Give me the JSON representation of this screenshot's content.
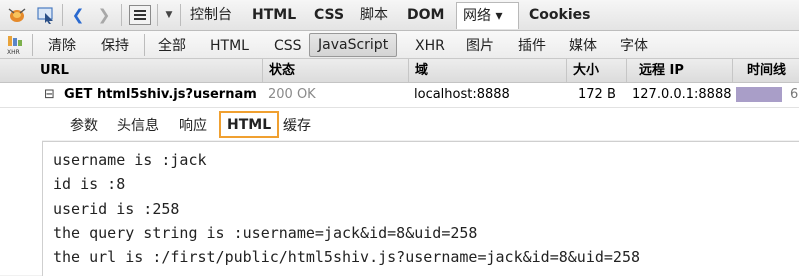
{
  "toolbar": {
    "icons": [
      "firebug-icon",
      "inspect-icon",
      "back-icon",
      "forward-icon",
      "menu-icon",
      "dropdown-icon"
    ],
    "tabs": [
      {
        "label": "控制台"
      },
      {
        "label": "HTML"
      },
      {
        "label": "CSS"
      },
      {
        "label": "脚本"
      },
      {
        "label": "DOM"
      },
      {
        "label": "网络 ▾"
      },
      {
        "label": "Cookies"
      }
    ]
  },
  "filters": {
    "items": [
      "清除",
      "保持",
      "全部",
      "HTML",
      "CSS",
      "JavaScript",
      "XHR",
      "图片",
      "插件",
      "媒体",
      "字体"
    ],
    "active": "JavaScript"
  },
  "columns": [
    "URL",
    "状态",
    "域",
    "大小",
    "远程 IP",
    "时间线"
  ],
  "request": {
    "toggle": "⊟",
    "url": "GET html5shiv.js?usernam",
    "status": "200 OK",
    "domain": "localhost:8888",
    "size": "172 B",
    "remote_ip": "127.0.0.1:8888",
    "timeline_text": "6"
  },
  "detail_tabs": [
    "参数",
    "头信息",
    "响应",
    "HTML",
    "缓存"
  ],
  "detail_active": "HTML",
  "response_lines": [
    "username is :jack",
    "id is :8",
    "userid is :258",
    "the query string is :username=jack&id=8&uid=258",
    "the url is :/first/public/html5shiv.js?username=jack&id=8&uid=258"
  ],
  "colors": {
    "active_tab_border": "#f0a030",
    "timeline_bar": "#a99ec8"
  }
}
